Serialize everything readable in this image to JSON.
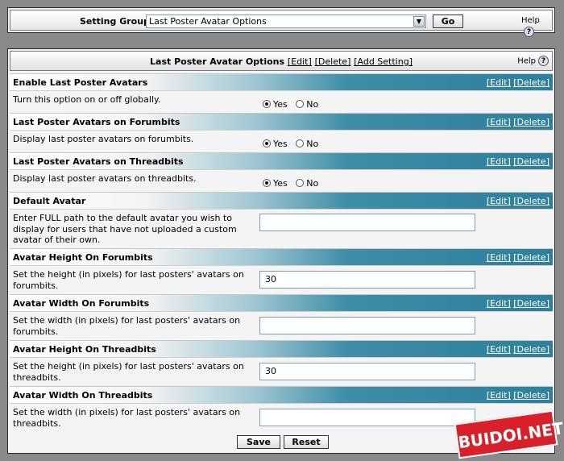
{
  "top": {
    "setting_group_label": "Setting Group",
    "setting_group_value": "Last Poster Avatar Options",
    "go_label": "Go",
    "help_label": "Help"
  },
  "main": {
    "title": "Last Poster Avatar Options",
    "edit_link": "[Edit]",
    "delete_link": "[Delete]",
    "add_setting_link": "[Add Setting]",
    "help_label": "Help",
    "links": {
      "edit": "[Edit]",
      "delete": "[Delete]"
    },
    "radio_yes": "Yes",
    "radio_no": "No",
    "settings": [
      {
        "title": "Enable Last Poster Avatars",
        "desc": "Turn this option on or off globally.",
        "value": "Yes"
      },
      {
        "title": "Last Poster Avatars on Forumbits",
        "desc": "Display last poster avatars on forumbits.",
        "value": "Yes"
      },
      {
        "title": "Last Poster Avatars on Threadbits",
        "desc": "Display last poster avatars on threadbits.",
        "value": "Yes"
      },
      {
        "title": "Default Avatar",
        "desc": "Enter FULL path to the default avatar you wish to display for users that have not uploaded a custom avatar of their own.",
        "value": ""
      },
      {
        "title": "Avatar Height On Forumbits",
        "desc": "Set the height (in pixels) for last posters' avatars on forumbits.",
        "value": "30"
      },
      {
        "title": "Avatar Width On Forumbits",
        "desc": "Set the width (in pixels) for last posters' avatars on forumbits.",
        "value": ""
      },
      {
        "title": "Avatar Height On Threadbits",
        "desc": "Set the height (in pixels) for last posters' avatars on threadbits.",
        "value": "30"
      },
      {
        "title": "Avatar Width On Threadbits",
        "desc": "Set the width (in pixels) for last posters' avatars on threadbits.",
        "value": ""
      }
    ],
    "save_label": "Save",
    "reset_label": "Reset"
  },
  "watermark": "BUIDOI.NET"
}
